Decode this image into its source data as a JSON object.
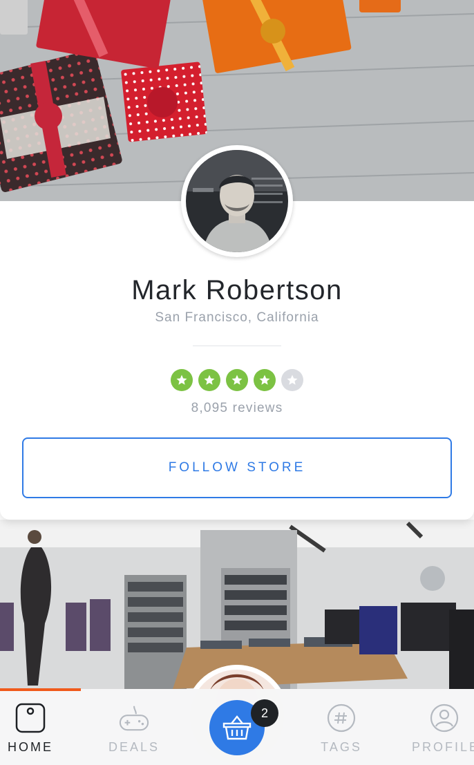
{
  "profile": {
    "name": "Mark Robertson",
    "location": "San Francisco, California",
    "rating": 4,
    "rating_max": 5,
    "reviews": "8,095 reviews",
    "follow_label": "FOLLOW STORE"
  },
  "colors": {
    "accent": "#2f7ae5",
    "star_filled": "#7cc243",
    "star_empty": "#d9dbe0",
    "progress": "#f05a1c"
  },
  "progress": {
    "fraction": 0.17
  },
  "tabbar": {
    "tabs": [
      {
        "label": "HOME",
        "icon": "home-square-icon",
        "active": true
      },
      {
        "label": "DEALS",
        "icon": "gamepad-icon",
        "active": false
      },
      {
        "label": "TAGS",
        "icon": "hashtag-icon",
        "active": false
      },
      {
        "label": "PROFILE",
        "icon": "user-icon",
        "active": false
      }
    ],
    "cart": {
      "icon": "basket-icon",
      "badge": "2"
    }
  }
}
